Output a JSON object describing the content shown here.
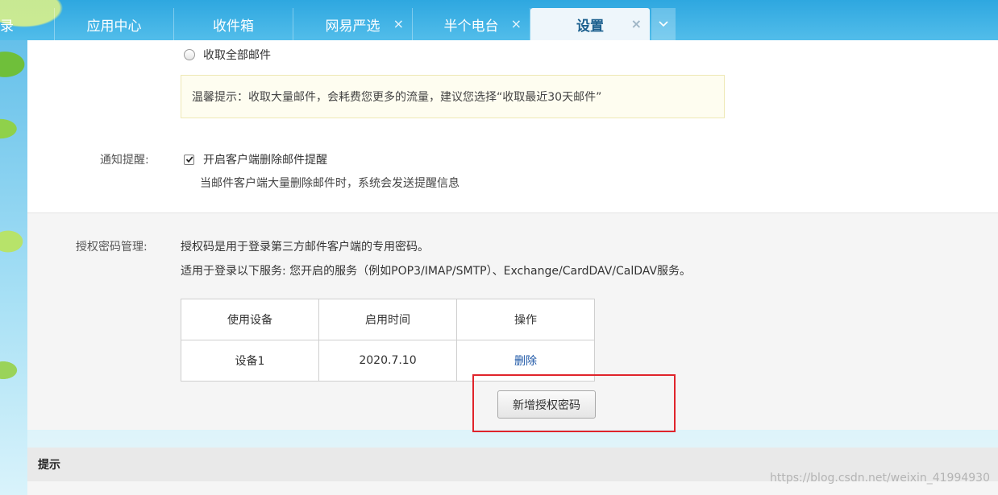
{
  "tabs": [
    {
      "label": "录",
      "closable": false
    },
    {
      "label": "应用中心",
      "closable": false
    },
    {
      "label": "收件箱",
      "closable": false
    },
    {
      "label": "网易严选",
      "closable": true
    },
    {
      "label": "半个电台",
      "closable": true
    },
    {
      "label": "设置",
      "closable": true,
      "active": true
    }
  ],
  "tab_close_glyph": "×",
  "receive": {
    "option_all": "收取全部邮件",
    "tip": "温馨提示：收取大量邮件，会耗费您更多的流量，建议您选择“收取最近30天邮件”"
  },
  "notify": {
    "label": "通知提醒:",
    "checkbox_label": "开启客户端删除邮件提醒",
    "checked": true,
    "note": "当邮件客户端大量删除邮件时，系统会发送提醒信息"
  },
  "auth": {
    "label": "授权密码管理:",
    "desc1": "授权码是用于登录第三方邮件客户端的专用密码。",
    "desc2": "适用于登录以下服务: 您开启的服务（例如POP3/IMAP/SMTP）、Exchange/CardDAV/CalDAV服务。",
    "table": {
      "headers": [
        "使用设备",
        "启用时间",
        "操作"
      ],
      "rows": [
        {
          "device": "设备1",
          "date": "2020.7.10",
          "action": "删除"
        }
      ]
    },
    "new_button": "新增授权密码"
  },
  "hint": {
    "title": "提示"
  },
  "watermark": "https://blog.csdn.net/weixin_41994930",
  "colors": {
    "accent": "#2ea7e0",
    "highlight": "#e0242b",
    "link": "#1c56a6"
  }
}
